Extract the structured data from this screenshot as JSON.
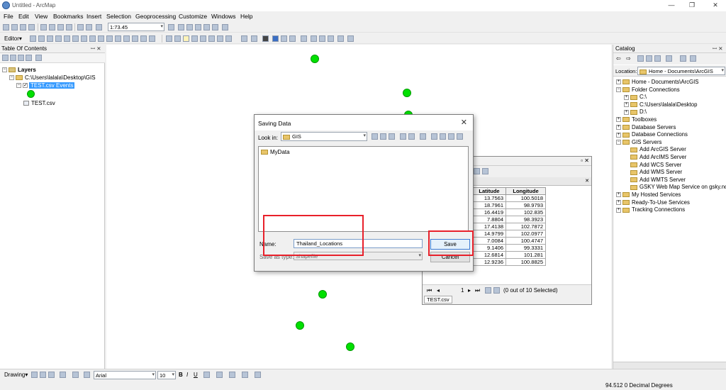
{
  "window": {
    "title": "Untitled - ArcMap",
    "controls": {
      "minimize": "—",
      "restore": "❐",
      "close": "✕"
    }
  },
  "menu": [
    "File",
    "Edit",
    "View",
    "Bookmarks",
    "Insert",
    "Selection",
    "Geoprocessing",
    "Customize",
    "Windows",
    "Help"
  ],
  "toolbar": {
    "scale": "1:73.45",
    "editor_label": "Editor▾"
  },
  "toc": {
    "title": "Table Of Contents",
    "pin_close": "ꟷ ✕",
    "layers_label": "Layers",
    "folder_path": "C:\\Users\\lalala\\Desktop\\GIS",
    "event_layer": "TEST.csv Events",
    "table_item": "TEST.csv"
  },
  "catalog": {
    "title": "Catalog",
    "location_label": "Location:",
    "location_value": "Home - Documents\\ArcGIS",
    "items": [
      {
        "label": "Home - Documents\\ArcGIS",
        "indent": 0,
        "exp": "+"
      },
      {
        "label": "Folder Connections",
        "indent": 0,
        "exp": "−"
      },
      {
        "label": "C:\\",
        "indent": 1,
        "exp": "+"
      },
      {
        "label": "C:\\Users\\lalala\\Desktop",
        "indent": 1,
        "exp": "+"
      },
      {
        "label": "D:\\",
        "indent": 1,
        "exp": "+"
      },
      {
        "label": "Toolboxes",
        "indent": 0,
        "exp": "+"
      },
      {
        "label": "Database Servers",
        "indent": 0,
        "exp": "+"
      },
      {
        "label": "Database Connections",
        "indent": 0,
        "exp": "+"
      },
      {
        "label": "GIS Servers",
        "indent": 0,
        "exp": "−"
      },
      {
        "label": "Add ArcGIS Server",
        "indent": 1,
        "exp": ""
      },
      {
        "label": "Add ArcIMS Server",
        "indent": 1,
        "exp": ""
      },
      {
        "label": "Add WCS Server",
        "indent": 1,
        "exp": ""
      },
      {
        "label": "Add WMS Server",
        "indent": 1,
        "exp": ""
      },
      {
        "label": "Add WMTS Server",
        "indent": 1,
        "exp": ""
      },
      {
        "label": "GSKY Web Map Service on gsky.nci",
        "indent": 1,
        "exp": ""
      },
      {
        "label": "My Hosted Services",
        "indent": 0,
        "exp": "+"
      },
      {
        "label": "Ready-To-Use Services",
        "indent": 0,
        "exp": "+"
      },
      {
        "label": "Tracking Connections",
        "indent": 0,
        "exp": "+"
      }
    ]
  },
  "attribute_table": {
    "columns": [
      "Latitude",
      "Longitude"
    ],
    "rows": [
      [
        "13.7563",
        "100.5018"
      ],
      [
        "18.7961",
        "98.9793"
      ],
      [
        "16.4419",
        "102.835"
      ],
      [
        "7.8804",
        "98.3923"
      ],
      [
        "17.4138",
        "102.7872"
      ],
      [
        "14.9799",
        "102.0977"
      ],
      [
        "7.0084",
        "100.4747"
      ],
      [
        "9.1406",
        "99.3331"
      ],
      [
        "12.6814",
        "101.281"
      ],
      [
        "12.9236",
        "100.8825"
      ]
    ],
    "record_nav": "1",
    "selected_status": "(0 out of 10 Selected)",
    "tab_name": "TEST.csv"
  },
  "dialog": {
    "title": "Saving Data",
    "look_in_label": "Look in:",
    "look_in_value": "GIS",
    "items": [
      "MyData"
    ],
    "name_label": "Name:",
    "name_value": "Thailand_Locations",
    "save_type_label": "Save as type:",
    "save_type_value": "Shapefile",
    "save_button": "Save",
    "cancel_button": "Cancel",
    "close": "✕"
  },
  "drawing_toolbar": {
    "label": "Drawing▾",
    "font": "Arial",
    "font_size": "10",
    "bold": "B",
    "italic": "I",
    "underline": "U"
  },
  "status": {
    "coordinates": "94.512  0 Decimal Degrees"
  },
  "colors": {
    "point_fill": "#00e000",
    "highlight": "#e8202a",
    "selected_layer": "#3399ff"
  }
}
